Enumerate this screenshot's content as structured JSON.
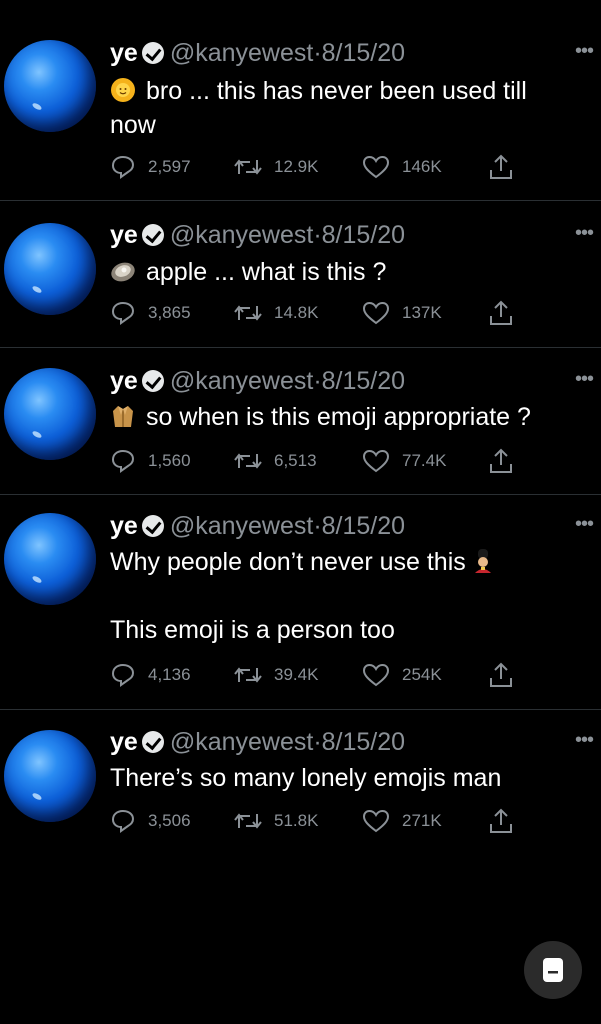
{
  "tweets": [
    {
      "name": "ye",
      "handle": "@kanyewest",
      "separator": "·",
      "date": "8/15/20",
      "emoji": "sun-with-face",
      "lines": [
        "bro ... this has never been used till",
        "now"
      ],
      "replies": "2,597",
      "retweets": "12.9K",
      "likes": "146K"
    },
    {
      "name": "ye",
      "handle": "@kanyewest",
      "separator": "·",
      "date": "8/15/20",
      "emoji": "oyster",
      "lines": [
        "apple ... what is this ?"
      ],
      "replies": "3,865",
      "retweets": "14.8K",
      "likes": "137K"
    },
    {
      "name": "ye",
      "handle": "@kanyewest",
      "separator": "·",
      "date": "8/15/20",
      "emoji": "coat",
      "lines": [
        "so when is this emoji appropriate ?"
      ],
      "replies": "1,560",
      "retweets": "6,513",
      "likes": "77.4K"
    },
    {
      "name": "ye",
      "handle": "@kanyewest",
      "separator": "·",
      "date": "8/15/20",
      "emoji": "guard",
      "lines": [
        "Why people don’t never use this",
        "",
        "This emoji is a person too"
      ],
      "replies": "4,136",
      "retweets": "39.4K",
      "likes": "254K"
    },
    {
      "name": "ye",
      "handle": "@kanyewest",
      "separator": "·",
      "date": "8/15/20",
      "emoji": "",
      "lines": [
        "There’s so many lonely emojis man"
      ],
      "replies": "3,506",
      "retweets": "51.8K",
      "likes": "271K"
    }
  ],
  "more_icon": "more-horizontal-icon",
  "fab_icon": "note-icon"
}
